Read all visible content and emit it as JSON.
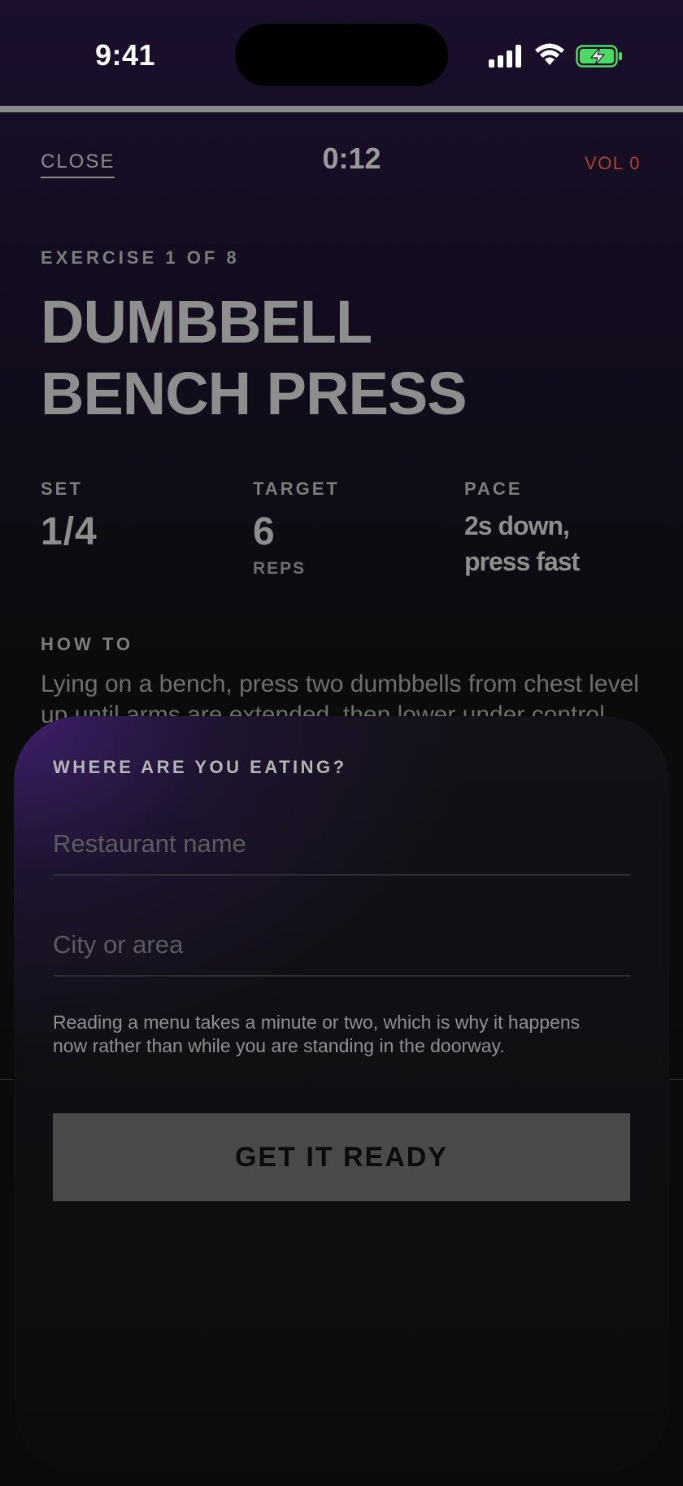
{
  "status_bar": {
    "time": "9:41",
    "icons": [
      "cellular-signal-icon",
      "wifi-icon",
      "battery-charging-icon"
    ],
    "battery_color": "#4cd964"
  },
  "workout": {
    "progress_fraction": 0.0,
    "close_label": "CLOSE",
    "timer": "0:12",
    "volume_label": "VOL 0",
    "exercise_count": "EXERCISE 1 OF 8",
    "exercise_title_line1": "DUMBBELL",
    "exercise_title_line2": "BENCH PRESS",
    "stats": {
      "set": {
        "label": "SET",
        "value": "1/4"
      },
      "target": {
        "label": "TARGET",
        "value": "6",
        "unit": "REPS"
      },
      "pace": {
        "label": "PACE",
        "value_line1": "2s down,",
        "value_line2": "press fast"
      }
    },
    "howto_label": "HOW TO",
    "howto_text": "Lying on a bench, press two dumbbells from chest level up until arms are extended, then lower under control."
  },
  "sheet": {
    "title": "WHERE ARE YOU EATING?",
    "restaurant_placeholder": "Restaurant name",
    "restaurant_value": "",
    "city_placeholder": "City or area",
    "city_value": "",
    "note": "Reading a menu takes a minute or two, which is why it happens now rather than while you are standing in the doorway.",
    "cta_label": "GET IT READY"
  },
  "colors": {
    "accent_volume": "#a8462b",
    "sheet_glow": "#402070",
    "cta_background": "#4a4a4a"
  }
}
